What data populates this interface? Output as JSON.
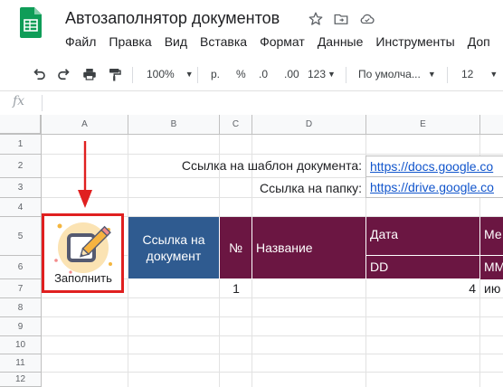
{
  "app": {
    "doc_title": "Автозаполнятор документов",
    "menu": [
      "Файл",
      "Правка",
      "Вид",
      "Вставка",
      "Формат",
      "Данные",
      "Инструменты",
      "Доп"
    ]
  },
  "toolbar": {
    "zoom": "100%",
    "currency": "р.",
    "percent": "%",
    "dec_less": ".0",
    "dec_more": ".00",
    "number_format": "123",
    "font": "По умолча...",
    "font_size": "12"
  },
  "formula_bar": {
    "fx": "fx",
    "value": ""
  },
  "grid": {
    "columns": [
      "A",
      "B",
      "C",
      "D",
      "E"
    ],
    "rows": [
      "1",
      "2",
      "3",
      "4",
      "5",
      "6",
      "7",
      "8",
      "9",
      "10",
      "11",
      "12"
    ]
  },
  "cells": {
    "template_label": "Ссылка на шаблон документа:",
    "template_link": "https://docs.google.co",
    "folder_label": "Ссылка на папку:",
    "folder_link": "https://drive.google.co",
    "header_link_line1": "Ссылка на",
    "header_link_line2": "документ",
    "header_number": "№",
    "header_name": "Название",
    "header_date": "Дата",
    "header_date_sub": "DD",
    "header_month": "Ме",
    "header_month_sub": "MM",
    "row7_number": "1",
    "row7_date": "4",
    "row7_month": "ию"
  },
  "fill_button": {
    "label": "Заполнить"
  },
  "colors": {
    "header_blue": "#2f5b90",
    "header_purple": "#6b1642",
    "highlight_red": "#e02020",
    "sheets_green": "#0f9d58"
  }
}
